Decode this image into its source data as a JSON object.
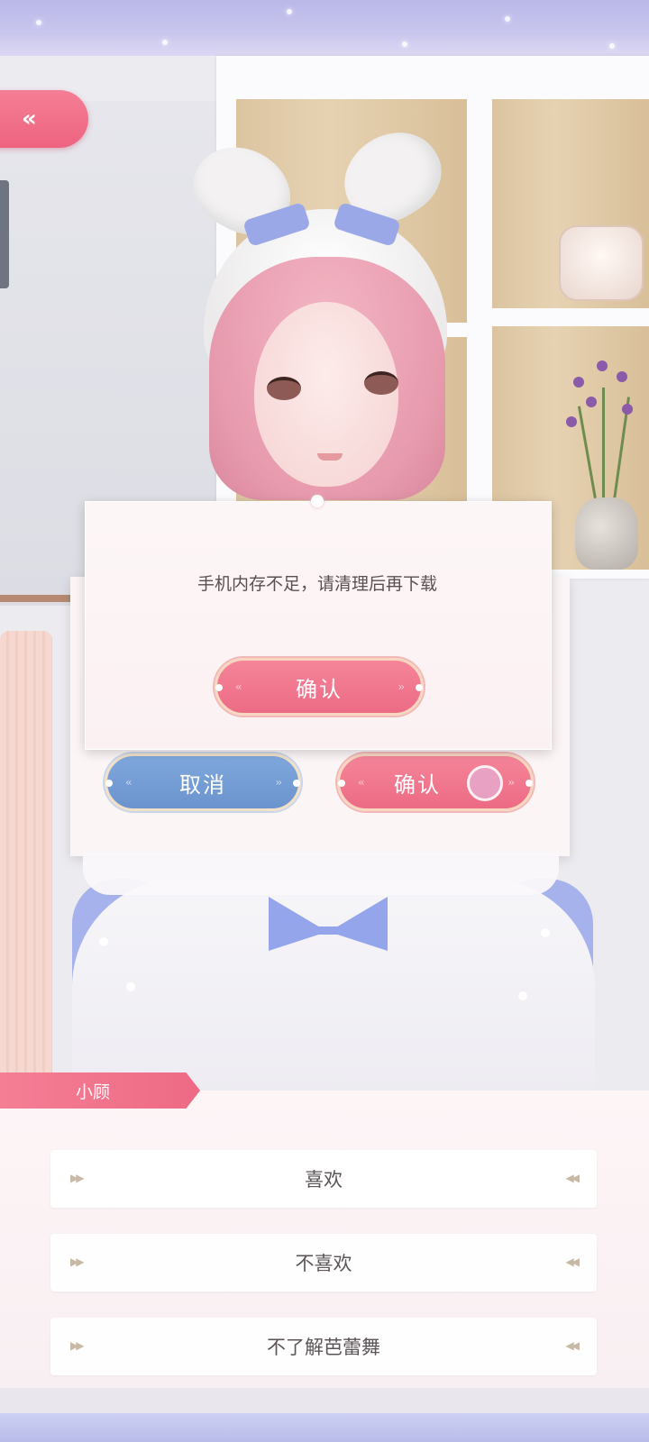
{
  "nav": {
    "back_icon_glyph": "«"
  },
  "dialog": {
    "message": "手机内存不足，请清理后再下载",
    "confirm_label": "确认"
  },
  "underlying_dialog": {
    "cancel_label": "取消",
    "confirm_label": "确认"
  },
  "conversation": {
    "speaker": "小顾",
    "options": [
      {
        "label": "喜欢"
      },
      {
        "label": "不喜欢"
      },
      {
        "label": "不了解芭蕾舞"
      }
    ]
  },
  "colors": {
    "accent_pink": "#ee6a84",
    "accent_blue": "#6b93cd",
    "frame_lavender": "#b9b8e8"
  }
}
